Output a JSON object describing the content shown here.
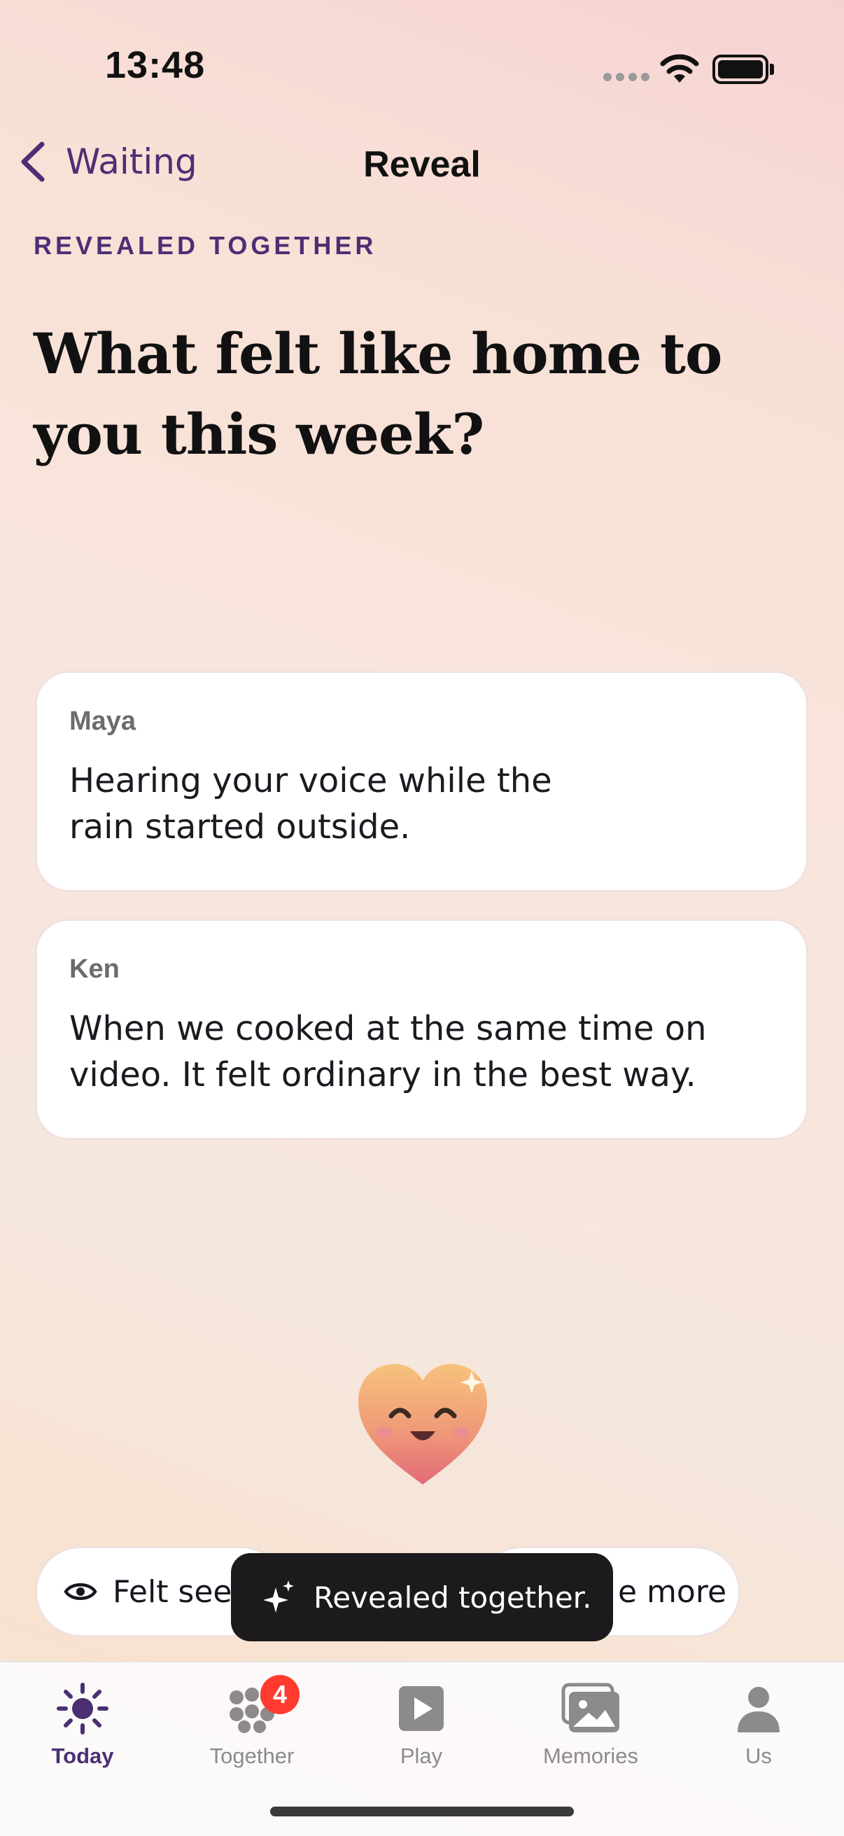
{
  "status": {
    "time": "13:48"
  },
  "nav": {
    "back_label": "Waiting",
    "title": "Reveal"
  },
  "eyebrow": "REVEALED TOGETHER",
  "question": "What felt like home to you this week?",
  "answers": [
    {
      "name": "Maya",
      "text": "Hearing your voice while the rain started outside."
    },
    {
      "name": "Ken",
      "text": "When we cooked at the same time on video. It felt ordinary in the best way."
    }
  ],
  "reactions": [
    {
      "label": "Felt seen",
      "icon": "eye-icon"
    },
    {
      "label": "e more",
      "icon": ""
    }
  ],
  "toast": {
    "label": "Revealed together.",
    "icon": "sparkles-icon"
  },
  "tabs": [
    {
      "label": "Today",
      "icon": "sun-icon",
      "active": true
    },
    {
      "label": "Together",
      "icon": "group-icon",
      "badge": "4"
    },
    {
      "label": "Play",
      "icon": "play-icon"
    },
    {
      "label": "Memories",
      "icon": "photos-icon"
    },
    {
      "label": "Us",
      "icon": "person-icon"
    }
  ],
  "colors": {
    "accent": "#4c2f73",
    "badge": "#ff3b30",
    "toast_bg": "#1d1a1d",
    "tab_inactive": "#8d8a8d"
  }
}
